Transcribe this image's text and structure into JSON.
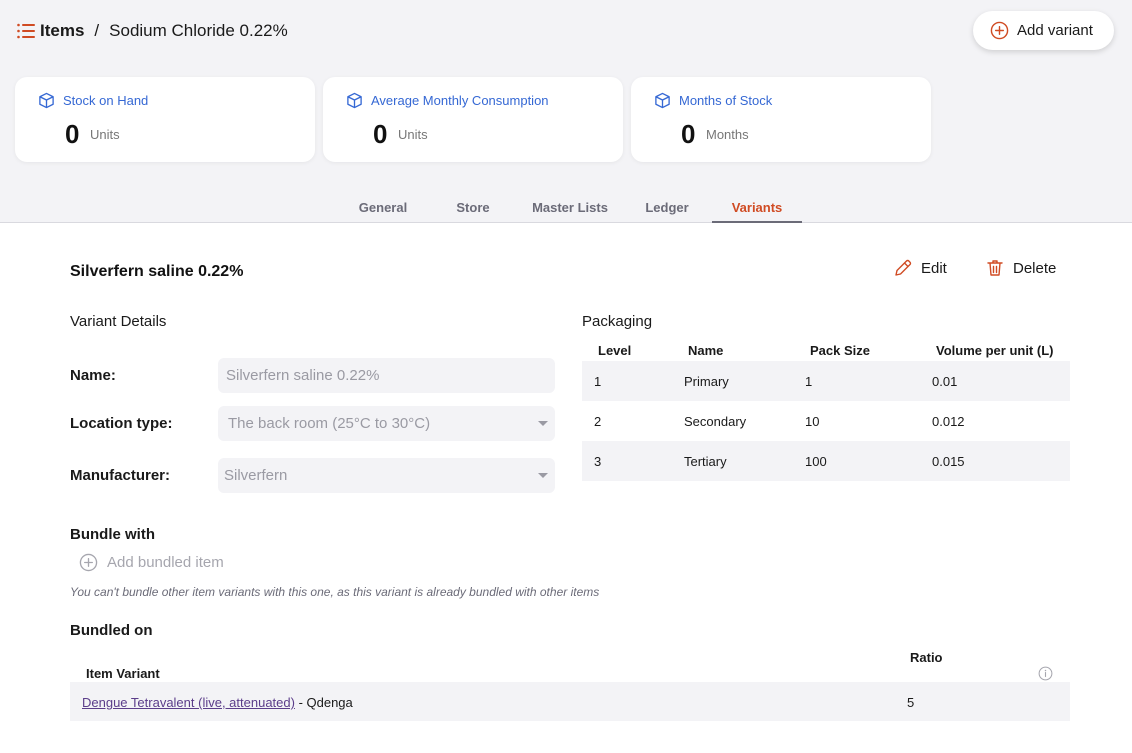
{
  "breadcrumb": {
    "parent": "Items",
    "separator": "/",
    "current": "Sodium Chloride 0.22%"
  },
  "header": {
    "add_variant_label": "Add variant"
  },
  "stats": [
    {
      "label": "Stock on Hand",
      "value": "0",
      "unit": "Units"
    },
    {
      "label": "Average Monthly Consumption",
      "value": "0",
      "unit": "Units"
    },
    {
      "label": "Months of Stock",
      "value": "0",
      "unit": "Months"
    }
  ],
  "tabs": [
    {
      "label": "General",
      "active": false
    },
    {
      "label": "Store",
      "active": false
    },
    {
      "label": "Master Lists",
      "active": false
    },
    {
      "label": "Ledger",
      "active": false
    },
    {
      "label": "Variants",
      "active": true
    }
  ],
  "variant": {
    "title": "Silverfern saline 0.22%",
    "edit_label": "Edit",
    "delete_label": "Delete",
    "details_heading": "Variant Details",
    "fields": {
      "name": {
        "label": "Name:",
        "value": "Silverfern saline 0.22%"
      },
      "location_type": {
        "label": "Location type:",
        "value": "The back room (25°C to 30°C)"
      },
      "manufacturer": {
        "label": "Manufacturer:",
        "value": "Silverfern"
      }
    }
  },
  "packaging": {
    "heading": "Packaging",
    "columns": [
      "Level",
      "Name",
      "Pack Size",
      "Volume per unit (L)"
    ],
    "rows": [
      [
        "1",
        "Primary",
        "1",
        "0.01"
      ],
      [
        "2",
        "Secondary",
        "10",
        "0.012"
      ],
      [
        "3",
        "Tertiary",
        "100",
        "0.015"
      ]
    ]
  },
  "bundle_with": {
    "heading": "Bundle with",
    "add_label": "Add bundled item",
    "note": "You can't bundle other item variants with this one, as this variant is already bundled with other items"
  },
  "bundled_on": {
    "heading": "Bundled on",
    "col_variant": "Item Variant",
    "col_ratio": "Ratio",
    "rows": [
      {
        "item_link": "Dengue Tetravalent (live, attenuated)",
        "variant_suffix": " - Qdenga",
        "ratio": "5"
      }
    ]
  },
  "colors": {
    "accent": "#d04b23",
    "link_blue": "#3568d4",
    "panel_bg": "#f3f3f6",
    "link_purple": "#5b3d8a"
  }
}
